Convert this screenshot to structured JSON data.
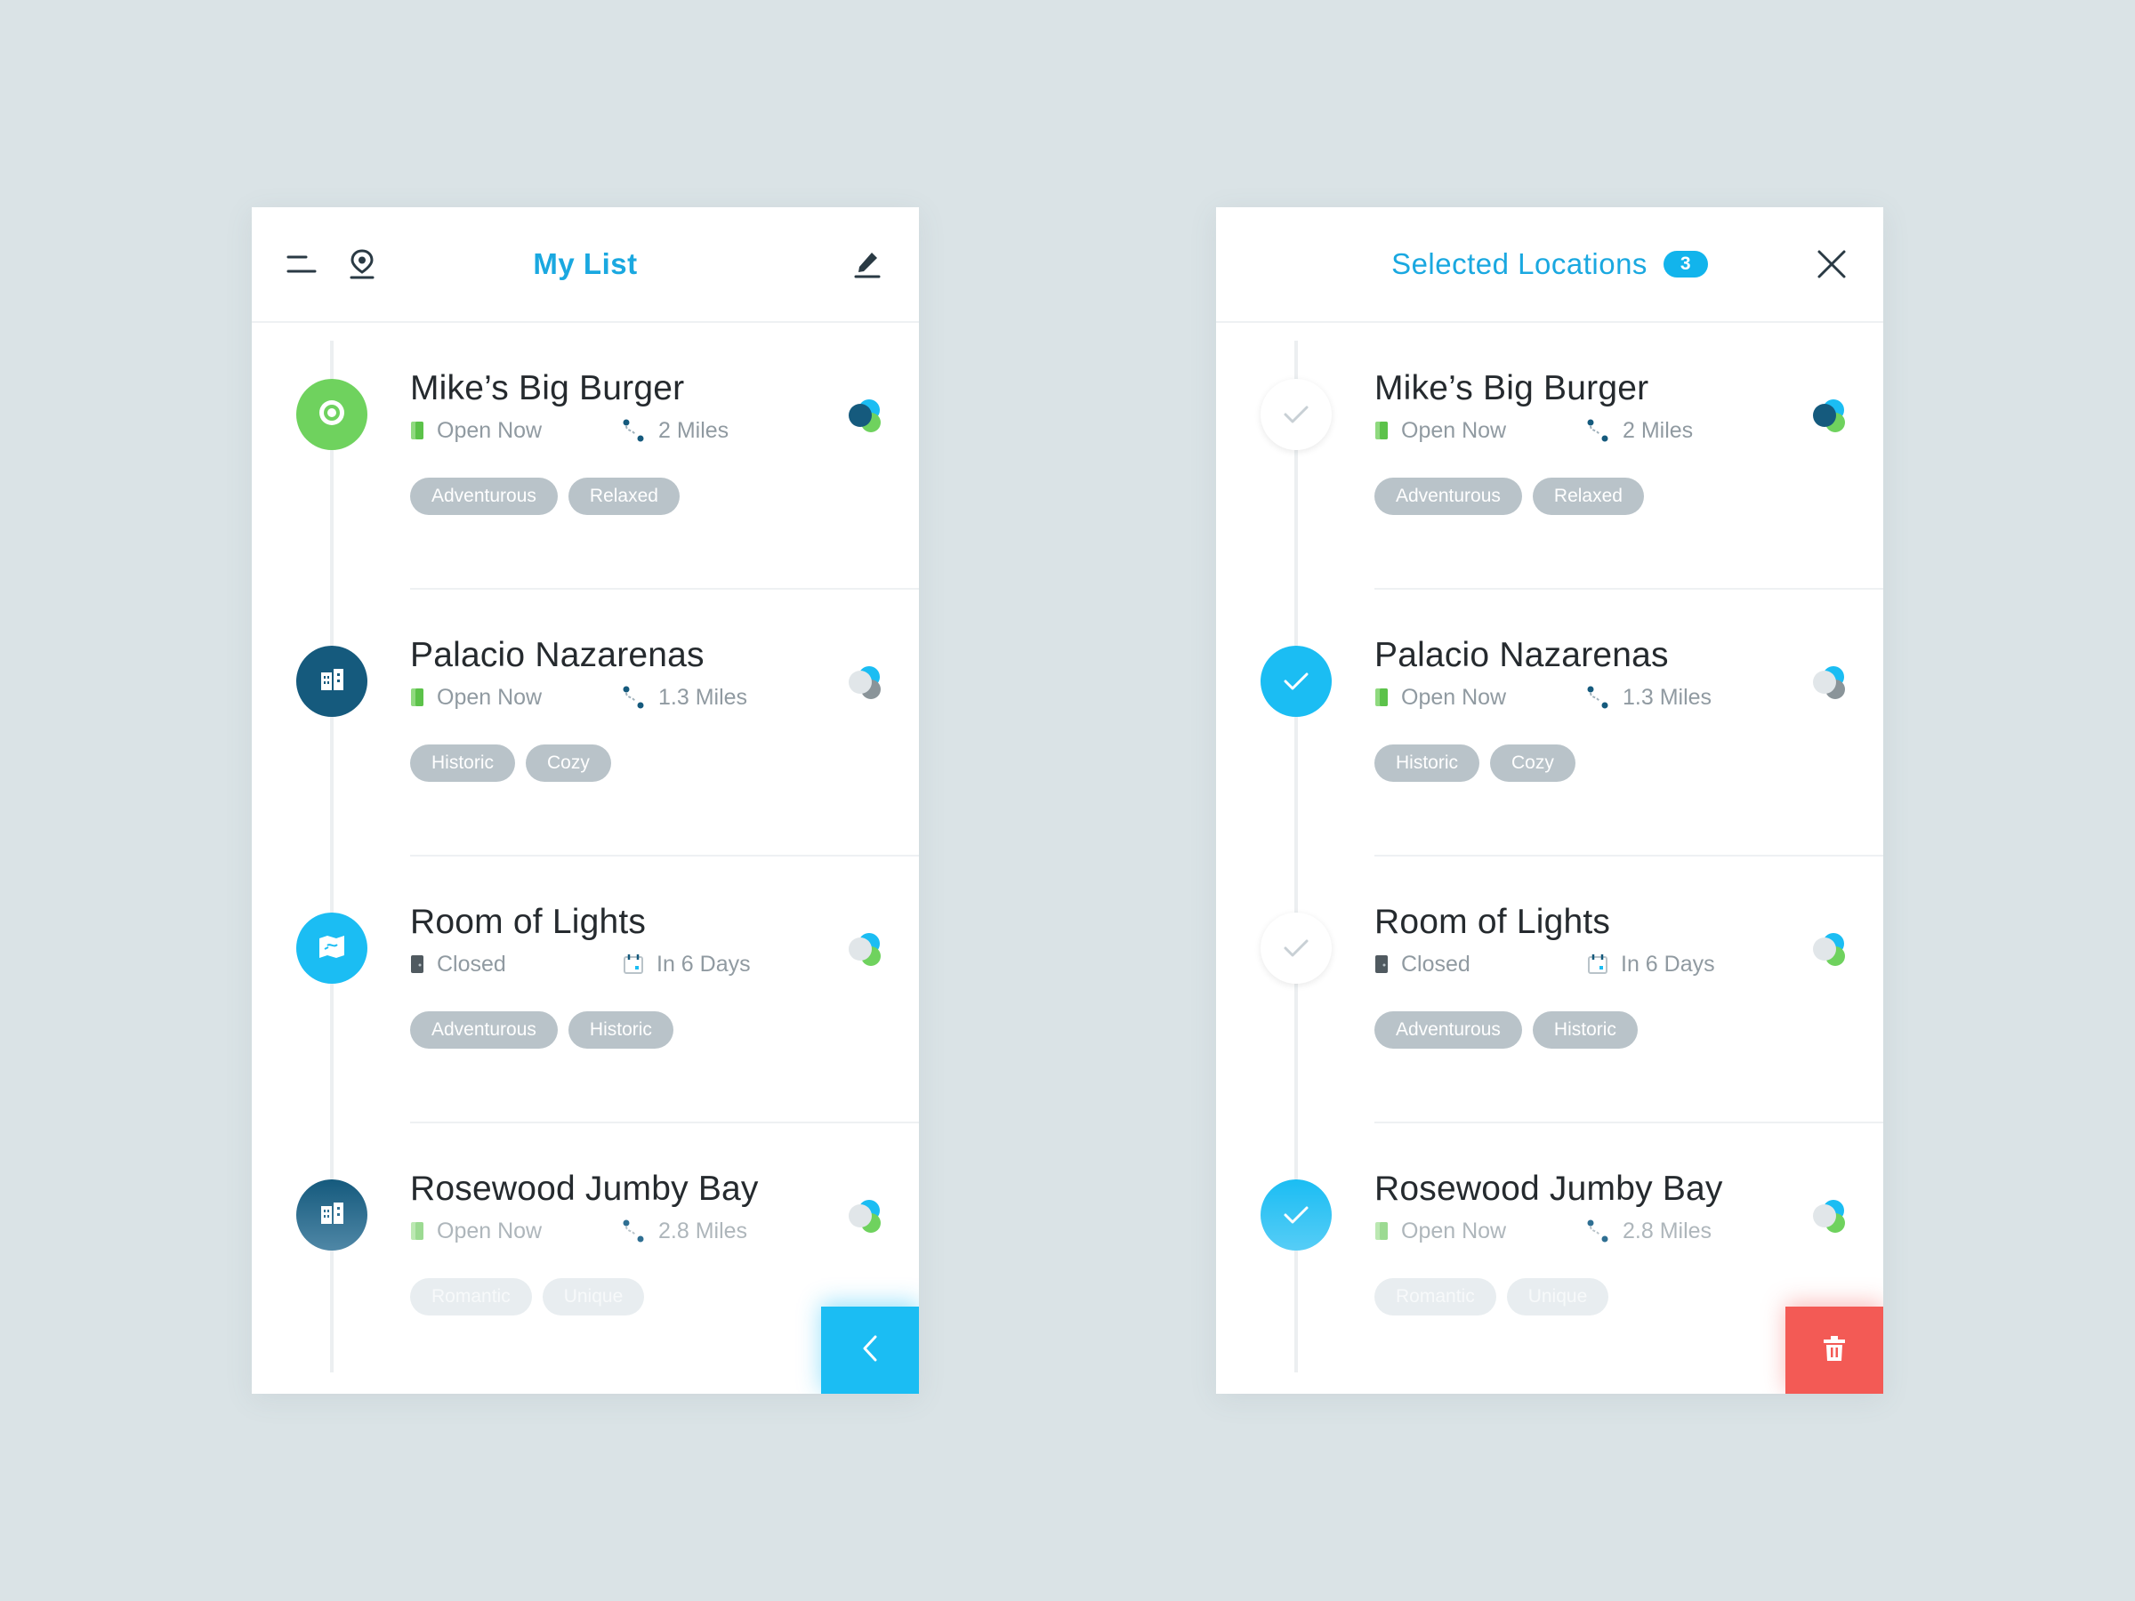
{
  "colors": {
    "accent": "#1bbdf3",
    "title_blue": "#1aa8e0",
    "green": "#6fd25e",
    "navy": "#155a7d",
    "delete_red": "#f35a55",
    "tag_gray": "#b9c3c9",
    "background": "#dae3e6"
  },
  "left_panel": {
    "title": "My List",
    "icons": [
      "menu-icon",
      "location-pin-icon",
      "edit-pencil-icon"
    ],
    "fab_icon": "chevron-left-icon",
    "items": [
      {
        "name": "Mike’s Big Burger",
        "status": "Open Now",
        "status_icon": "open-door-icon",
        "detail": "2 Miles",
        "detail_icon": "route-icon",
        "tags": [
          "Adventurous",
          "Relaxed"
        ],
        "category_icon": "food-plate-icon",
        "marker_color": "green"
      },
      {
        "name": "Palacio Nazarenas",
        "status": "Open Now",
        "status_icon": "open-door-icon",
        "detail": "1.3 Miles",
        "detail_icon": "route-icon",
        "tags": [
          "Historic",
          "Cozy"
        ],
        "category_icon": "building-icon",
        "marker_color": "navy"
      },
      {
        "name": "Room of Lights",
        "status": "Closed",
        "status_icon": "closed-door-icon",
        "detail": "In 6 Days",
        "detail_icon": "calendar-icon",
        "tags": [
          "Adventurous",
          "Historic"
        ],
        "category_icon": "map-icon",
        "marker_color": "sky"
      },
      {
        "name": "Rosewood Jumby Bay",
        "status": "Open Now",
        "status_icon": "open-door-icon",
        "detail": "2.8 Miles",
        "detail_icon": "route-icon",
        "tags": [
          "Romantic",
          "Unique"
        ],
        "category_icon": "building-icon",
        "marker_color": "navy"
      }
    ]
  },
  "right_panel": {
    "title": "Selected Locations",
    "selected_count": "3",
    "icons": [
      "close-icon"
    ],
    "fab_icon": "trash-icon",
    "items": [
      {
        "name": "Mike’s Big Burger",
        "status": "Open Now",
        "detail": "2 Miles",
        "tags": [
          "Adventurous",
          "Relaxed"
        ],
        "selected": false
      },
      {
        "name": "Palacio Nazarenas",
        "status": "Open Now",
        "detail": "1.3 Miles",
        "tags": [
          "Historic",
          "Cozy"
        ],
        "selected": true
      },
      {
        "name": "Room of Lights",
        "status": "Closed",
        "detail": "In 6 Days",
        "tags": [
          "Adventurous",
          "Historic"
        ],
        "selected": false
      },
      {
        "name": "Rosewood Jumby Bay",
        "status": "Open Now",
        "detail": "2.8 Miles",
        "tags": [
          "Romantic",
          "Unique"
        ],
        "selected": true
      }
    ]
  }
}
